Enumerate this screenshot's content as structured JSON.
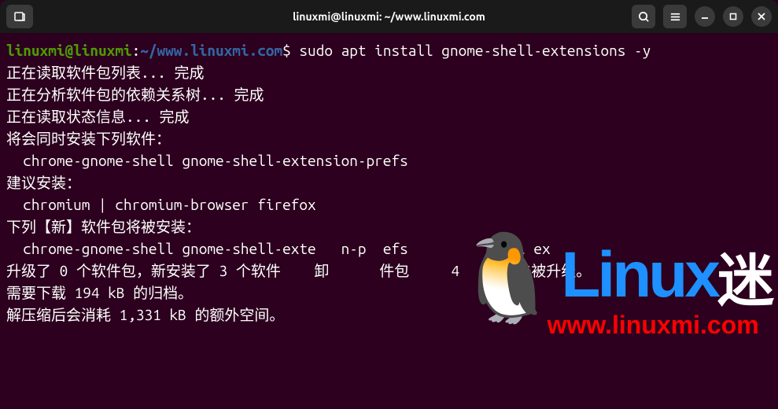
{
  "titlebar": {
    "title": "linuxmi@linuxmi: ~/www.linuxmi.com"
  },
  "prompt": {
    "user": "linuxmi@linuxmi",
    "sep1": ":",
    "path": "~/www.linuxmi.com",
    "sep2": "$ "
  },
  "command": "sudo apt install gnome-shell-extensions -y",
  "output": {
    "line1": "正在读取软件包列表... 完成",
    "line2": "正在分析软件包的依赖关系树... 完成",
    "line3": "正在读取状态信息... 完成",
    "line4": "将会同时安装下列软件：",
    "line5": "  chrome-gnome-shell gnome-shell-extension-prefs",
    "line6": "建议安装：",
    "line7": "  chromium | chromium-browser firefox",
    "line8": "下列【新】软件包将被安装：",
    "line9_a": "  chrome-gnome-shell gnome-shell-exte",
    "line9_b": "n-p",
    "line9_c": "efs",
    "line9_d": "ell ex",
    "line10_a": "升级了 0 个软件包，新安装了 3 个软件",
    "line10_b": "卸",
    "line10_c": "件包",
    "line10_d": "4",
    "line10_e": "包未被升级。",
    "line11": "需要下载 194 kB 的归档。",
    "line12": "解压缩后会消耗 1,331 kB 的额外空间。"
  },
  "watermark": {
    "linux": "Linux",
    "mi": "迷",
    "url": "www.linuxmi.com"
  }
}
